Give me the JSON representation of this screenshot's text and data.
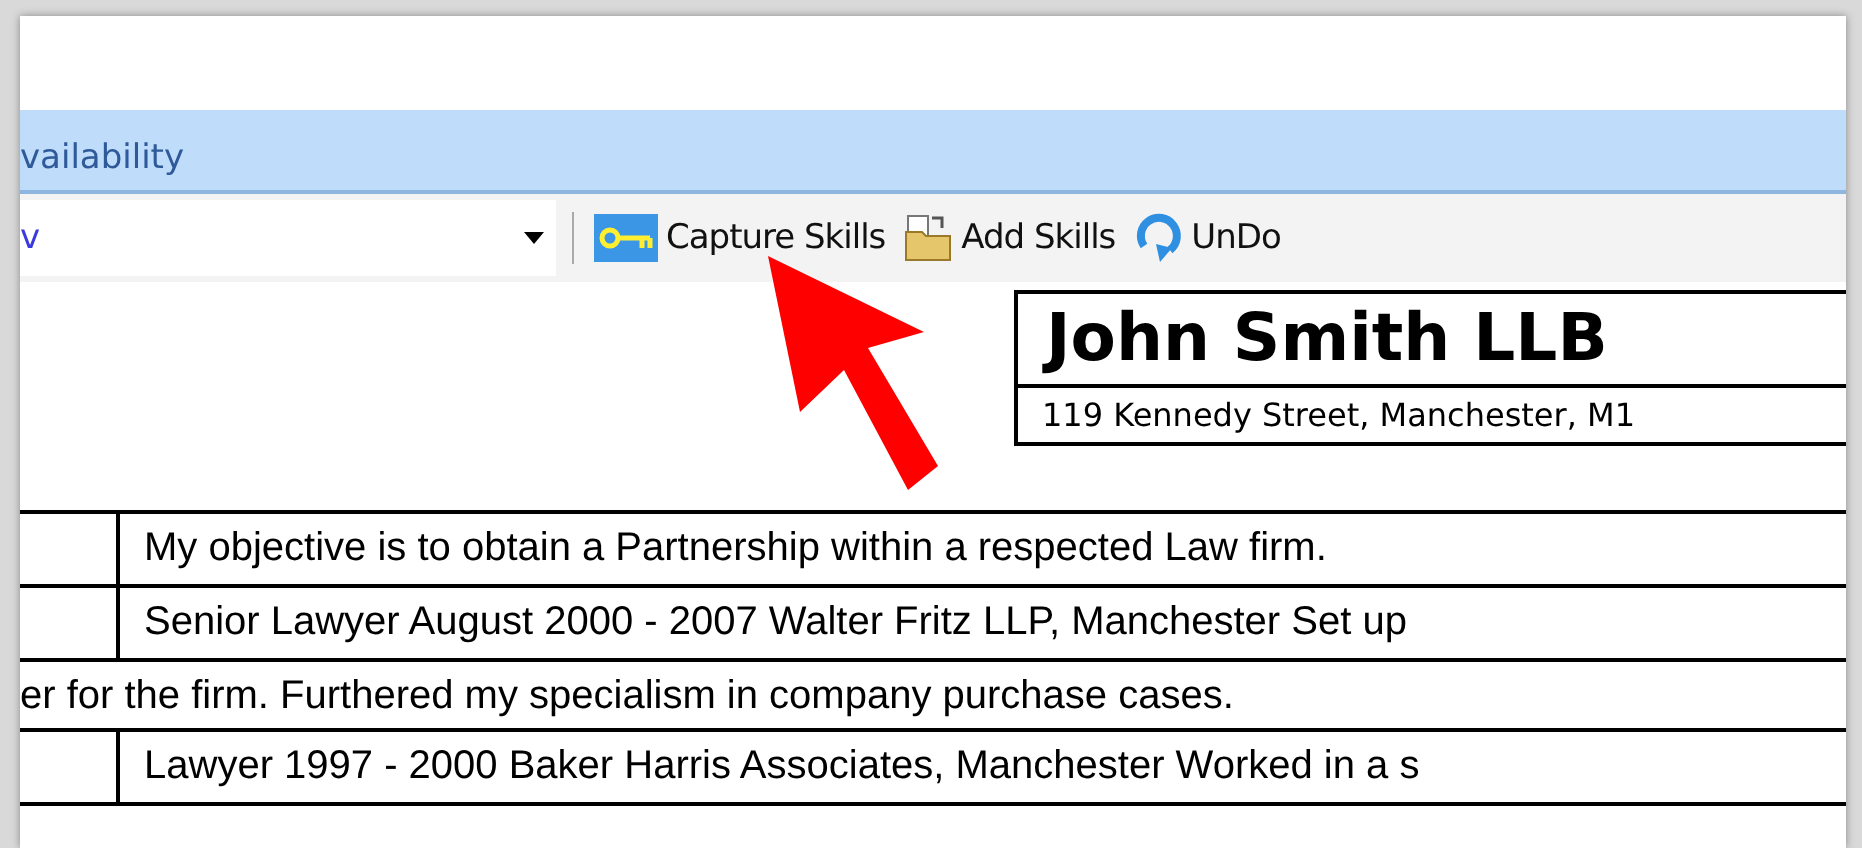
{
  "tab_band": {
    "label": "vailability"
  },
  "toolbar": {
    "combo_value": "v",
    "buttons": [
      {
        "kind": "key",
        "label": "Capture Skills"
      },
      {
        "kind": "folder",
        "label": "Add Skills"
      },
      {
        "kind": "undo",
        "label": "UnDo"
      }
    ]
  },
  "document": {
    "name": "John Smith LLB",
    "address": "119 Kennedy Street, Manchester, M1",
    "rows": [
      {
        "kind": "cell",
        "text": "My objective is to obtain a Partnership within a respected Law firm."
      },
      {
        "kind": "cell",
        "text": "Senior Lawyer August 2000 - 2007  Walter Fritz LLP, Manchester Set up"
      },
      {
        "kind": "continuation",
        "text": "er for the firm. Furthered my specialism in company purchase cases."
      },
      {
        "kind": "cell",
        "text": "Lawyer 1997 - 2000  Baker Harris Associates, Manchester Worked in a s"
      }
    ]
  }
}
